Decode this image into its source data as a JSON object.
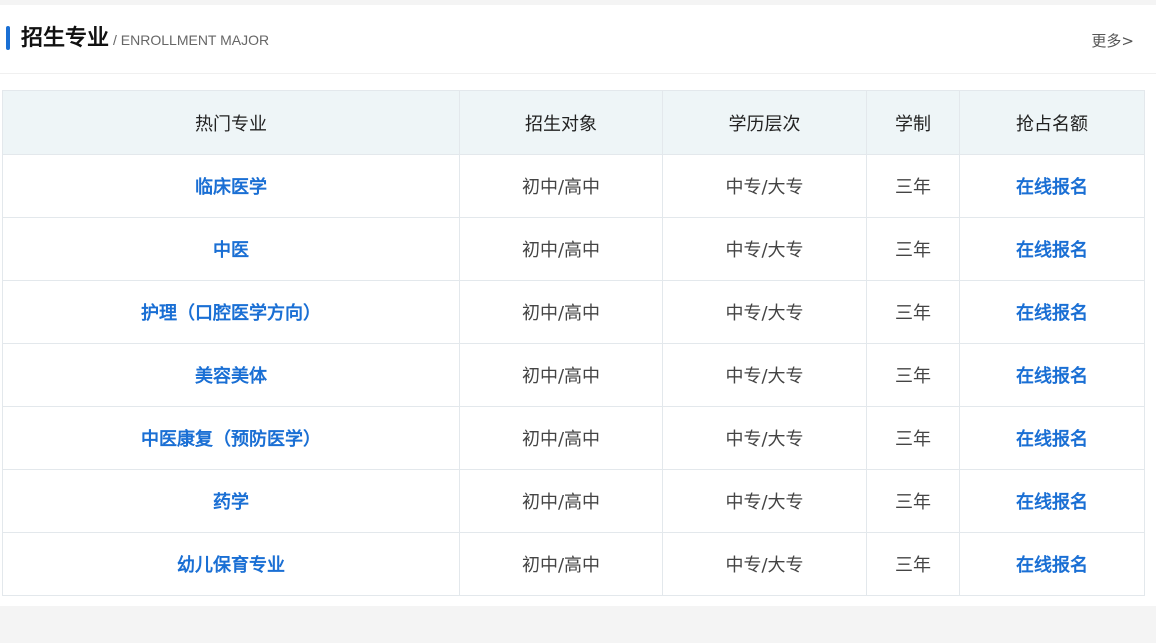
{
  "header": {
    "title": "招生专业",
    "subtitle": "/ ENROLLMENT MAJOR",
    "more": "更多>"
  },
  "table": {
    "columns": [
      "热门专业",
      "招生对象",
      "学历层次",
      "学制",
      "抢占名额"
    ],
    "rows": [
      {
        "major": "临床医学",
        "target": "初中/高中",
        "level": "中专/大专",
        "duration": "三年",
        "action": "在线报名"
      },
      {
        "major": "中医",
        "target": "初中/高中",
        "level": "中专/大专",
        "duration": "三年",
        "action": "在线报名"
      },
      {
        "major": "护理（口腔医学方向）",
        "target": "初中/高中",
        "level": "中专/大专",
        "duration": "三年",
        "action": "在线报名"
      },
      {
        "major": "美容美体",
        "target": "初中/高中",
        "level": "中专/大专",
        "duration": "三年",
        "action": "在线报名"
      },
      {
        "major": "中医康复（预防医学）",
        "target": "初中/高中",
        "level": "中专/大专",
        "duration": "三年",
        "action": "在线报名"
      },
      {
        "major": "药学",
        "target": "初中/高中",
        "level": "中专/大专",
        "duration": "三年",
        "action": "在线报名"
      },
      {
        "major": "幼儿保育专业",
        "target": "初中/高中",
        "level": "中专/大专",
        "duration": "三年",
        "action": "在线报名"
      }
    ]
  },
  "colors": {
    "accent": "#1a6fd4",
    "header_bg": "#eef5f7",
    "border": "#e3e8ec",
    "page_bg": "#f4f4f4"
  }
}
